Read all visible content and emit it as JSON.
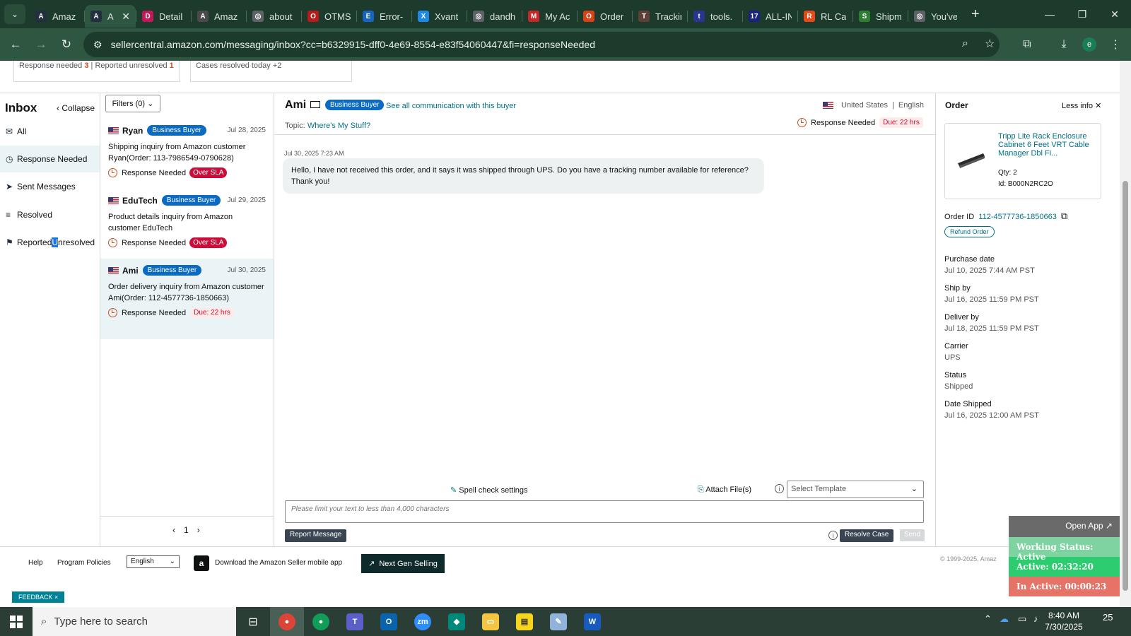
{
  "browser": {
    "tabs": [
      {
        "label": "Amaz",
        "favicon": "A",
        "color": "#232f3e"
      },
      {
        "label": "A",
        "favicon": "A",
        "color": "#232f3e",
        "active": true
      },
      {
        "label": "Detail",
        "favicon": "D",
        "color": "#c2185b"
      },
      {
        "label": "Amaz",
        "favicon": "A",
        "color": "#4a4a4a"
      },
      {
        "label": "about",
        "favicon": "◎",
        "color": "#5f6368"
      },
      {
        "label": "OTMS",
        "favicon": "O",
        "color": "#b71c1c"
      },
      {
        "label": "Error-",
        "favicon": "E",
        "color": "#1565c0"
      },
      {
        "label": "Xvant",
        "favicon": "X",
        "color": "#1e88e5"
      },
      {
        "label": "dandh",
        "favicon": "◎",
        "color": "#5f6368"
      },
      {
        "label": "My Ac",
        "favicon": "M",
        "color": "#c62828"
      },
      {
        "label": "Order",
        "favicon": "O",
        "color": "#d84315"
      },
      {
        "label": "Trackin",
        "favicon": "T",
        "color": "#5d4037"
      },
      {
        "label": "tools.",
        "favicon": "t",
        "color": "#283593"
      },
      {
        "label": "ALL-IN",
        "favicon": "17",
        "color": "#1a237e"
      },
      {
        "label": "RL Ca",
        "favicon": "R",
        "color": "#e64a19"
      },
      {
        "label": "Shipm",
        "favicon": "S",
        "color": "#2e7d32"
      },
      {
        "label": "You've",
        "favicon": "◎",
        "color": "#5f6368"
      }
    ],
    "url": "sellercentral.amazon.com/messaging/inbox?cc=b6329915-dff0-4e69-8554-e83f54060447&fi=responseNeeded",
    "profile_initial": "e"
  },
  "stats": {
    "card1_prefix": "Response needed",
    "card1_count": "3",
    "card1_sep": "|",
    "card1_label2": "Reported unresolved",
    "card1_count2": "1",
    "card2_label": "Cases resolved today",
    "card2_count": "+2"
  },
  "nav": {
    "title": "Inbox",
    "collapse": "Collapse",
    "items": [
      {
        "label": "All",
        "icon": "mail-icon"
      },
      {
        "label": "Response Needed",
        "icon": "clock-icon"
      },
      {
        "label": "Sent Messages",
        "icon": "send-icon"
      },
      {
        "label": "Resolved",
        "icon": "check-list-icon"
      },
      {
        "label_a": "Reported ",
        "label_hl": "U",
        "label_b": "nresolved",
        "icon": "person-flag-icon"
      }
    ]
  },
  "list": {
    "filters": "Filters (0)",
    "page": "1",
    "conversations": [
      {
        "name": "Ryan",
        "badge": "Business Buyer",
        "date": "Jul 28, 2025",
        "subject": "Shipping inquiry from Amazon customer Ryan(Order: 113-7986549-0790628)",
        "status": "Response Needed",
        "flag": "Over SLA"
      },
      {
        "name": "EduTech",
        "badge": "Business Buyer",
        "date": "Jul 29, 2025",
        "subject": "Product details inquiry from Amazon customer EduTech",
        "status": "Response Needed",
        "flag": "Over SLA"
      },
      {
        "name": "Ami",
        "badge": "Business Buyer",
        "date": "Jul 30, 2025",
        "subject": "Order delivery inquiry from Amazon customer Ami(Order: 112-4577736-1850663)",
        "status": "Response Needed",
        "flag": "Due: 22 hrs"
      }
    ]
  },
  "message": {
    "buyer": "Ami",
    "badge": "Business Buyer",
    "see_all": "See all communication with this buyer",
    "country": "United States",
    "sep": "|",
    "language": "English",
    "topic_label": "Topic:",
    "topic": "Where's My Stuff?",
    "response_needed": "Response Needed",
    "due": "Due: 22 hrs",
    "timestamp": "Jul 30, 2025 7:23 AM",
    "body": "Hello, I have not received this order, and it says it was shipped through UPS. Do you have a tracking number available for reference? Thank you!",
    "spell_check": "Spell check settings",
    "attach": "Attach File(s)",
    "template_placeholder": "Select Template",
    "input_placeholder": "Please limit your text to less than 4,000 characters",
    "report": "Report Message",
    "resolve": "Resolve Case",
    "send": "Send"
  },
  "order": {
    "title": "Order",
    "less_info": "Less info",
    "product_title": "Tripp Lite Rack Enclosure Cabinet 6 Feet VRT Cable Manager Dbl Fi...",
    "qty_label": "Qty:",
    "qty": "2",
    "id_label": "Id:",
    "asin": "B000N2RC2O",
    "order_id_label": "Order ID",
    "order_id": "112-4577736-1850663",
    "refund": "Refund Order",
    "fields": [
      {
        "label": "Purchase date",
        "value": "Jul 10, 2025 7:44 AM PST"
      },
      {
        "label": "Ship by",
        "value": "Jul 16, 2025 11:59 PM PST"
      },
      {
        "label": "Deliver by",
        "value": "Jul 18, 2025 11:59 PM PST"
      },
      {
        "label": "Carrier",
        "value": "UPS"
      },
      {
        "label": "Status",
        "value": "Shipped"
      },
      {
        "label": "Date Shipped",
        "value": "Jul 16, 2025 12:00 AM PST"
      }
    ]
  },
  "footer": {
    "help": "Help",
    "policies": "Program Policies",
    "language": "English",
    "download": "Download the Amazon Seller mobile app",
    "next_gen": "Next Gen Selling",
    "copyright": "© 1999-2025, Amaz",
    "feedback": "FEEDBACK ×"
  },
  "work_status": {
    "open_app": "Open App ↗",
    "status": "Working Status: Active",
    "active": "Active: 02:32:20",
    "inactive": "In Active: 00:00:23",
    "colors": {
      "status": "#7fd3a0",
      "active": "#2ecc71",
      "inactive": "#e57368"
    }
  },
  "taskbar": {
    "search_placeholder": "Type here to search",
    "time": "8:40 AM",
    "date": "7/30/2025",
    "notifications": "25"
  }
}
